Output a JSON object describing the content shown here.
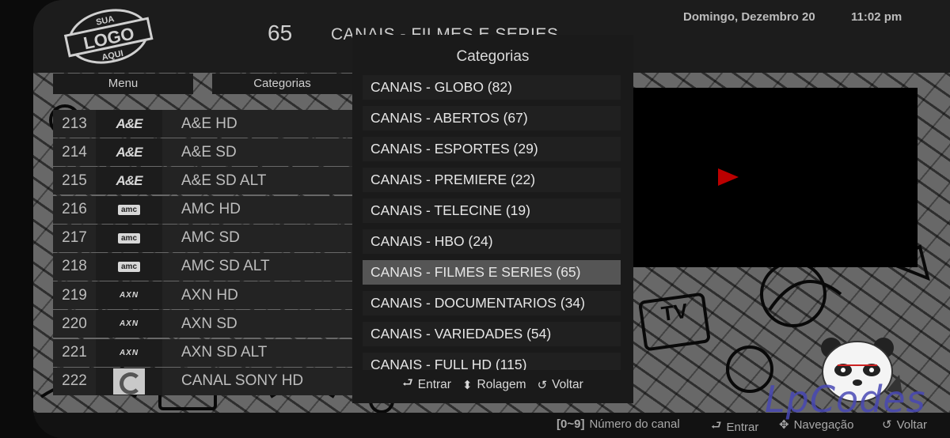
{
  "header": {
    "logo": {
      "top": "SUA",
      "middle": "LOGO",
      "bottom": "AQUI"
    },
    "channel_count": "65",
    "category_title": "CANAIS - FILMES E SERIES",
    "date": "Domingo, Dezembro 20",
    "time": "11:02 pm"
  },
  "tabs": [
    {
      "label": "Menu"
    },
    {
      "label": "Categorias"
    }
  ],
  "channels": [
    {
      "number": "213",
      "logo": "A&E",
      "name": "A&E HD"
    },
    {
      "number": "214",
      "logo": "A&E",
      "name": "A&E SD"
    },
    {
      "number": "215",
      "logo": "A&E",
      "name": "A&E SD ALT"
    },
    {
      "number": "216",
      "logo": "amc",
      "name": "AMC HD"
    },
    {
      "number": "217",
      "logo": "amc",
      "name": "AMC SD"
    },
    {
      "number": "218",
      "logo": "amc",
      "name": "AMC SD ALT"
    },
    {
      "number": "219",
      "logo": "AXN",
      "name": "AXN HD"
    },
    {
      "number": "220",
      "logo": "AXN",
      "name": "AXN SD"
    },
    {
      "number": "221",
      "logo": "AXN",
      "name": "AXN SD ALT"
    },
    {
      "number": "222",
      "logo": "sony-logo",
      "name": "CANAL SONY HD"
    }
  ],
  "dialog": {
    "title": "Categorias",
    "items": [
      {
        "label": "CANAIS - GLOBO (82)"
      },
      {
        "label": "CANAIS - ABERTOS (67)"
      },
      {
        "label": "CANAIS - ESPORTES (29)"
      },
      {
        "label": "CANAIS - PREMIERE (22)"
      },
      {
        "label": "CANAIS - TELECINE (19)"
      },
      {
        "label": "CANAIS - HBO (24)"
      },
      {
        "label": "CANAIS - FILMES E SERIES (65)"
      },
      {
        "label": "CANAIS - DOCUMENTARIOS (34)"
      },
      {
        "label": "CANAIS - VARIEDADES (54)"
      },
      {
        "label": "CANAIS - FULL HD (115)"
      }
    ],
    "selected_index": 6,
    "footer": {
      "enter": "Entrar",
      "scroll": "Rolagem",
      "back": "Voltar"
    }
  },
  "bottom_bar": {
    "keys": "[0~9]",
    "channel_number": "Número do canal",
    "enter": "Entrar",
    "navigation": "Navegação",
    "back": "Voltar"
  },
  "watermark": "LpCodes",
  "colors": {
    "selected_bg": "#555555",
    "play_icon": "#bb0000",
    "watermark": "#4848b4"
  },
  "icons": [
    "enter-icon",
    "scroll-updown-icon",
    "back-arrow-icon",
    "play-icon",
    "panda-icon"
  ]
}
